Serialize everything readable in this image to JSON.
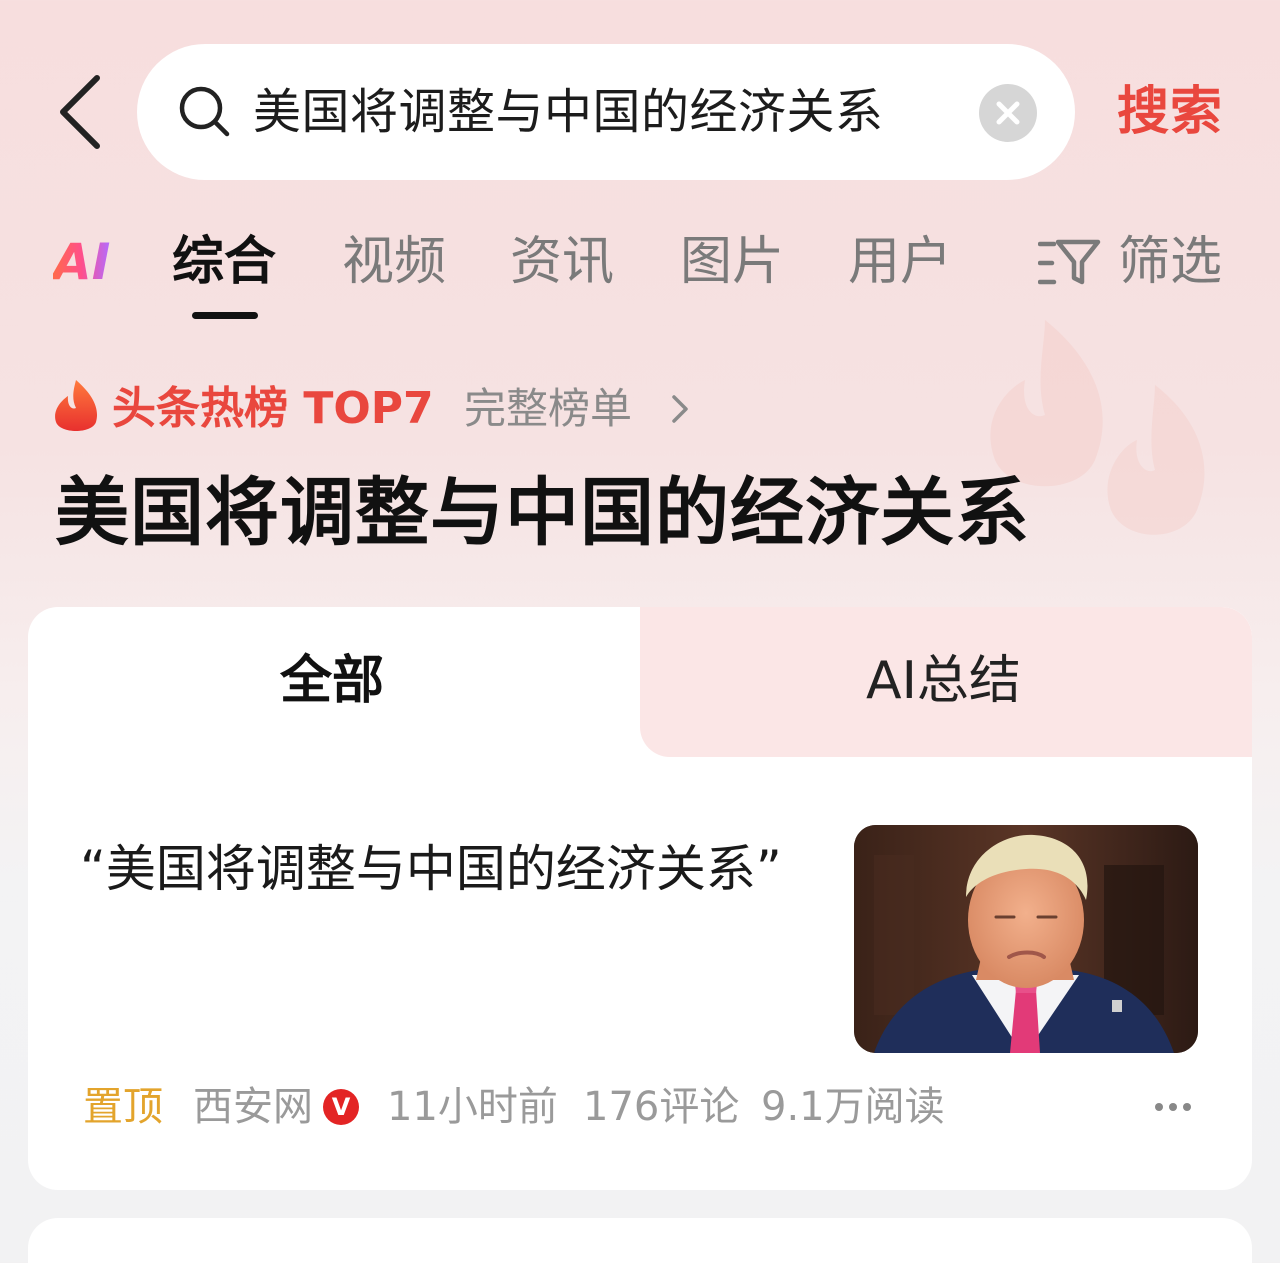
{
  "header": {
    "search_query": "美国将调整与中国的经济关系",
    "search_button": "搜索"
  },
  "tabs": {
    "ai_logo": "AI",
    "items": [
      "综合",
      "视频",
      "资讯",
      "图片",
      "用户"
    ],
    "active_index": 0,
    "filter_label": "筛选"
  },
  "hot_list": {
    "label": "头条热榜 TOP7",
    "full_list_link": "完整榜单"
  },
  "topic": {
    "title": "美国将调整与中国的经济关系"
  },
  "segments": {
    "all": "全部",
    "ai_summary": "AI总结",
    "active": "all"
  },
  "news": {
    "title": "“美国将调整与中国的经济关系”",
    "pin_label": "置顶",
    "source": "西安网",
    "verified_badge": "V",
    "time": "11小时前",
    "comments": "176评论",
    "reads": "9.1万阅读"
  },
  "colors": {
    "accent_red": "#e9473e",
    "pin_orange": "#e3a42c",
    "segment_pink": "#fbe6e6"
  },
  "icons": [
    "back-arrow-icon",
    "search-icon",
    "clear-icon",
    "filter-icon",
    "flame-icon",
    "chevron-right-icon",
    "verified-icon",
    "more-icon"
  ]
}
